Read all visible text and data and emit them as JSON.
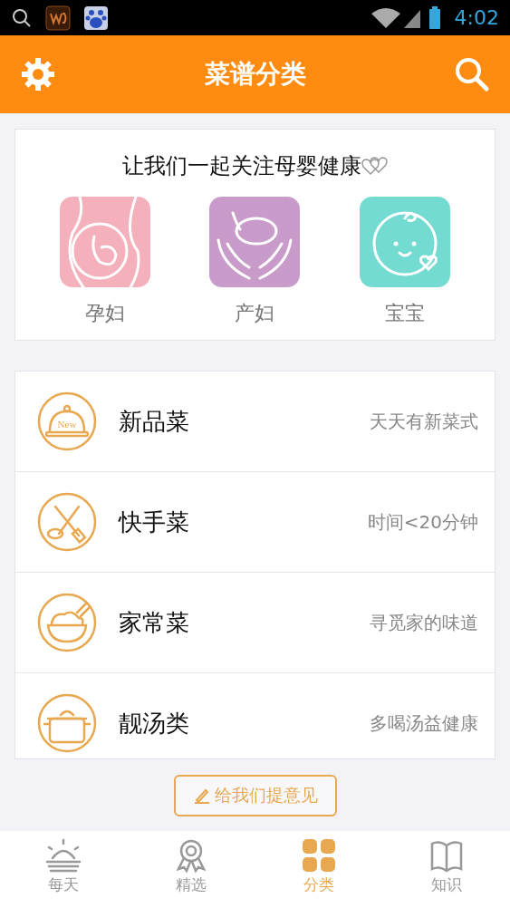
{
  "status_bar": {
    "time": "4:02"
  },
  "header": {
    "title": "菜谱分类"
  },
  "care_card": {
    "title": "让我们一起关注母婴健康",
    "groups": [
      {
        "kind": "pregnant",
        "label": "孕妇",
        "color": "#f4b0bb"
      },
      {
        "kind": "mother",
        "label": "产妇",
        "color": "#c99bcb"
      },
      {
        "kind": "baby",
        "label": "宝宝",
        "color": "#74dbd2"
      }
    ]
  },
  "categories": [
    {
      "kind": "new",
      "name": "新品菜",
      "note": "天天有新菜式",
      "badge": "New"
    },
    {
      "kind": "quick",
      "name": "快手菜",
      "note": "时间<20分钟"
    },
    {
      "kind": "home",
      "name": "家常菜",
      "note": "寻觅家的味道"
    },
    {
      "kind": "soup",
      "name": "靓汤类",
      "note": "多喝汤益健康"
    }
  ],
  "feedback_button": "给我们提意见",
  "tabs": [
    {
      "kind": "daily",
      "label": "每天",
      "selected": false
    },
    {
      "kind": "featured",
      "label": "精选",
      "selected": false
    },
    {
      "kind": "category",
      "label": "分类",
      "selected": true
    },
    {
      "kind": "knowledge",
      "label": "知识",
      "selected": false
    }
  ]
}
